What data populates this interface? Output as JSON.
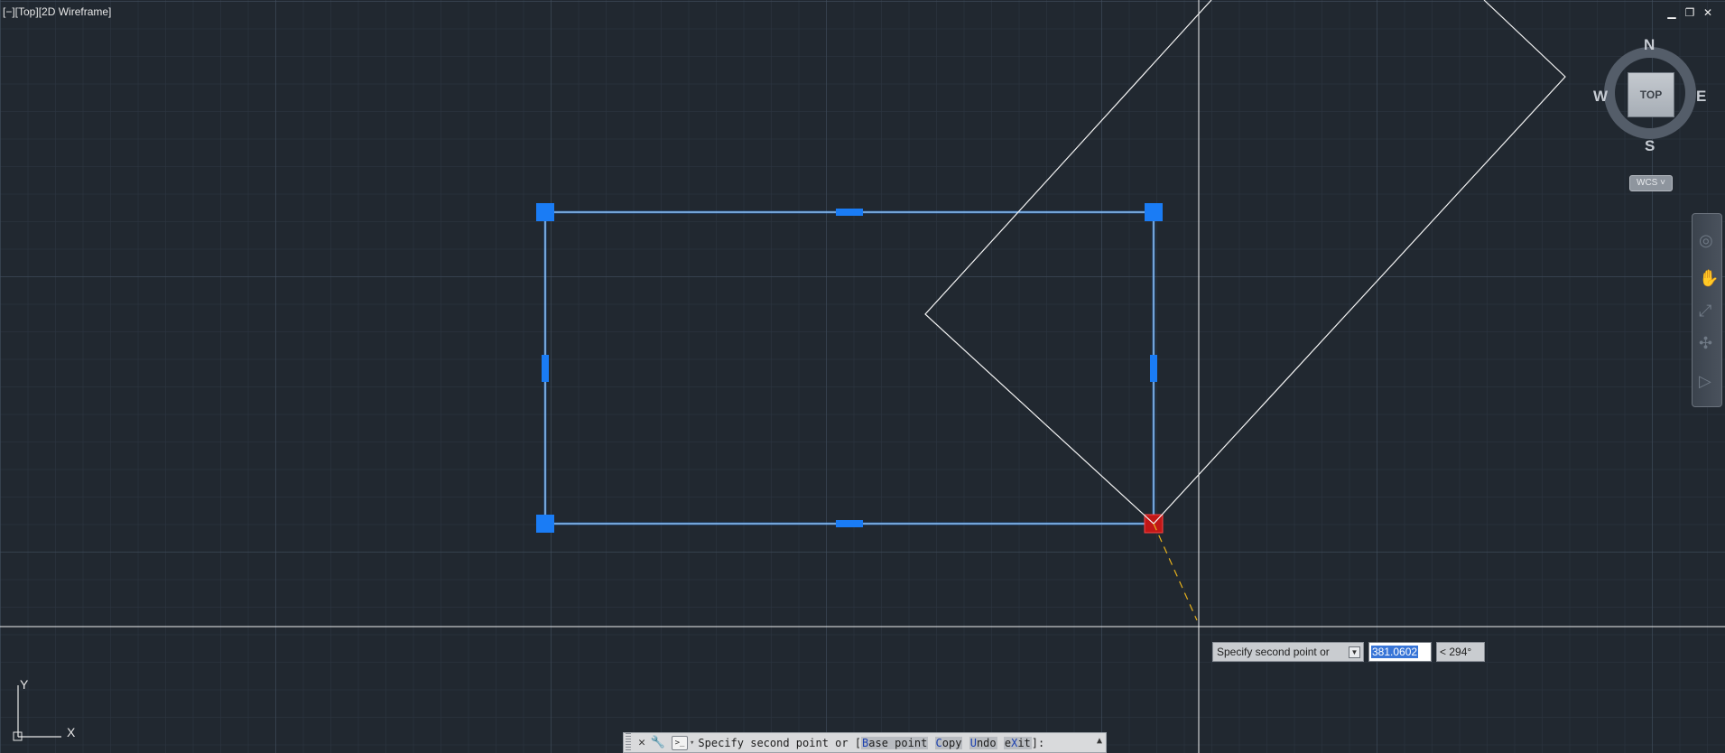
{
  "viewport": {
    "label": "[−][Top][2D Wireframe]",
    "window_controls": [
      "▁",
      "❐",
      "✕"
    ]
  },
  "viewcube": {
    "top": "TOP",
    "north": "N",
    "south": "S",
    "east": "E",
    "west": "W",
    "wcs": "WCS ˅"
  },
  "navbar": {
    "icons": [
      "steering-wheel-icon",
      "pan-icon",
      "zoom-icon",
      "orbit-icon",
      "showmotion-icon"
    ]
  },
  "ucs": {
    "x_label": "X",
    "y_label": "Y"
  },
  "dynamic_input": {
    "prompt": "Specify second point or",
    "distance": "381.0602",
    "angle": "< 294°"
  },
  "command_line": {
    "prefix": "Specify second point or [",
    "options": [
      {
        "hotkey": "B",
        "rest": "ase point"
      },
      {
        "hotkey": "C",
        "rest": "opy"
      },
      {
        "hotkey": "U",
        "rest": "ndo"
      },
      {
        "hotkey": "e",
        "mid": "X",
        "rest": "it"
      }
    ],
    "suffix": "]:"
  },
  "colors": {
    "background": "#212830",
    "selection": "#2d8cff",
    "grip": "#1a7cf5",
    "hot_grip": "#c11717",
    "rubber_band": "#e8b21c"
  }
}
